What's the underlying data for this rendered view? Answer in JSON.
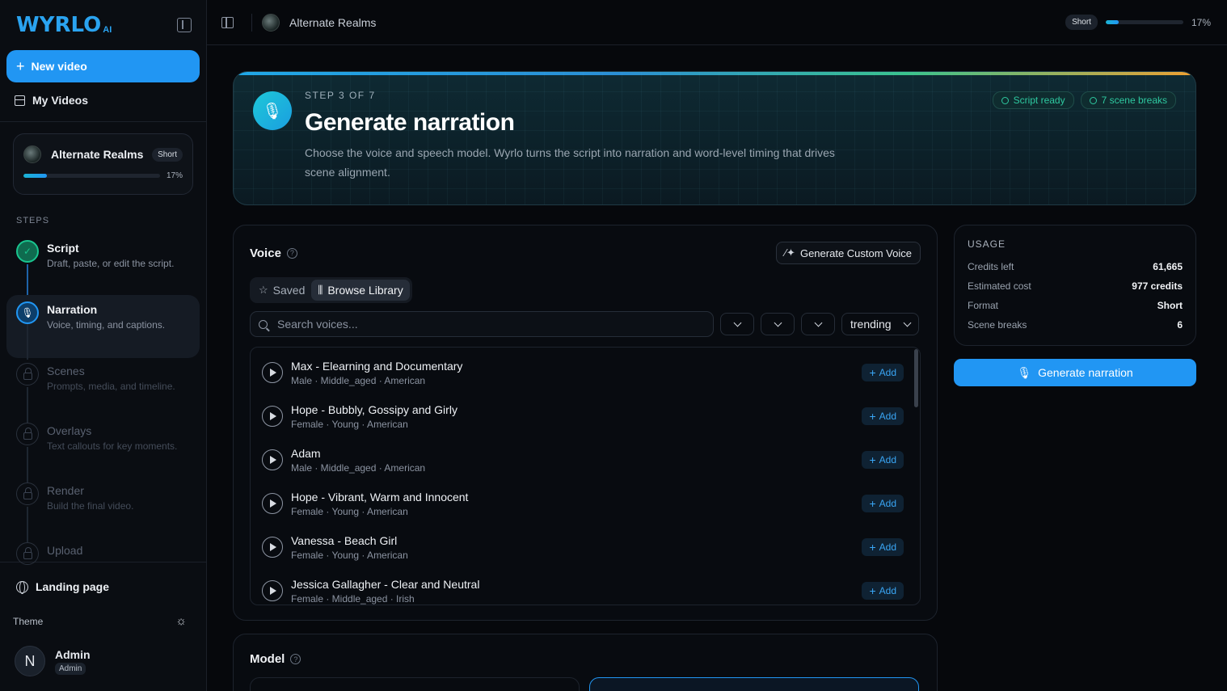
{
  "sidebar": {
    "logo_text": "WYRLO",
    "logo_suffix": "AI",
    "new_video_label": "New video",
    "my_videos_label": "My Videos",
    "project": {
      "title": "Alternate Realms",
      "format": "Short",
      "progress_pct": 17,
      "progress_label": "17%"
    },
    "steps_heading": "STEPS",
    "steps": [
      {
        "title": "Script",
        "desc": "Draft, paste, or edit the script.",
        "state": "done"
      },
      {
        "title": "Narration",
        "desc": "Voice, timing, and captions.",
        "state": "current"
      },
      {
        "title": "Scenes",
        "desc": "Prompts, media, and timeline.",
        "state": "locked"
      },
      {
        "title": "Overlays",
        "desc": "Text callouts for key moments.",
        "state": "locked"
      },
      {
        "title": "Render",
        "desc": "Build the final video.",
        "state": "locked"
      },
      {
        "title": "Upload",
        "desc": "",
        "state": "locked"
      }
    ],
    "landing_label": "Landing page",
    "theme_label": "Theme",
    "user": {
      "initial": "N",
      "name": "Admin",
      "role": "Admin"
    }
  },
  "topbar": {
    "project_title": "Alternate Realms",
    "format": "Short",
    "progress_pct": 17,
    "progress_label": "17%"
  },
  "hero": {
    "step_label": "STEP 3 OF 7",
    "title": "Generate narration",
    "description": "Choose the voice and speech model. Wyrlo turns the script into narration and word-level timing that drives scene alignment.",
    "tags": [
      "Script ready",
      "7 scene breaks"
    ]
  },
  "voice": {
    "title": "Voice",
    "custom_voice_label": "Generate Custom Voice",
    "tabs": [
      {
        "label": "Saved",
        "active": false
      },
      {
        "label": "Browse Library",
        "active": true
      }
    ],
    "search_placeholder": "Search voices...",
    "sort_value": "trending",
    "voices": [
      {
        "name": "Max - Elearning and Documentary",
        "meta": "Male · Middle_aged · American"
      },
      {
        "name": "Hope - Bubbly, Gossipy and Girly",
        "meta": "Female · Young · American"
      },
      {
        "name": "Adam",
        "meta": "Male · Middle_aged · American"
      },
      {
        "name": "Hope - Vibrant, Warm and Innocent",
        "meta": "Female · Young · American"
      },
      {
        "name": "Vanessa - Beach Girl",
        "meta": "Female · Young · American"
      },
      {
        "name": "Jessica Gallagher - Clear and Neutral",
        "meta": "Female · Middle_aged · Irish"
      }
    ],
    "add_label": "Add"
  },
  "usage": {
    "title": "USAGE",
    "rows": [
      {
        "key": "Credits left",
        "value": "61,665"
      },
      {
        "key": "Estimated cost",
        "value": "977 credits"
      },
      {
        "key": "Format",
        "value": "Short"
      },
      {
        "key": "Scene breaks",
        "value": "6"
      }
    ],
    "generate_label": "Generate narration"
  },
  "model": {
    "title": "Model"
  },
  "colors": {
    "accent": "#2196f3",
    "success": "#19c48e",
    "tag_green": "#2ec9a0",
    "background": "#06080c"
  },
  "icons": [
    "collapse-sidebar-icon",
    "plus-icon",
    "grid-icon",
    "check-icon",
    "microphone-icon",
    "lock-icon",
    "globe-icon",
    "sun-icon",
    "panel-icon",
    "help-icon",
    "wand-icon",
    "star-icon",
    "library-icon",
    "search-icon",
    "chevron-down-icon",
    "play-icon"
  ]
}
